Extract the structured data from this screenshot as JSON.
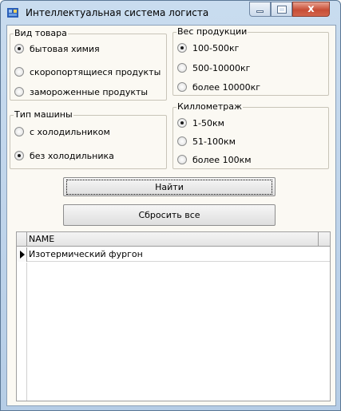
{
  "window": {
    "title": "Интеллектуальная система логиста",
    "controls": {
      "minimize": "",
      "maximize": "",
      "close": "x"
    }
  },
  "product_type": {
    "legend": "Вид товара",
    "options": [
      {
        "label": "бытовая химия",
        "selected": true
      },
      {
        "label": "скоропортящиеся продукты",
        "selected": false
      },
      {
        "label": "замороженные продукты",
        "selected": false
      }
    ]
  },
  "weight": {
    "legend": "Вес продукции",
    "options": [
      {
        "label": "100-500кг",
        "selected": true
      },
      {
        "label": "500-10000кг",
        "selected": false
      },
      {
        "label": "более 10000кг",
        "selected": false
      }
    ]
  },
  "vehicle_type": {
    "legend": "Тип машины",
    "options": [
      {
        "label": "с холодильником",
        "selected": false
      },
      {
        "label": "без холодильника",
        "selected": true
      }
    ]
  },
  "distance": {
    "legend": "Киллометраж",
    "options": [
      {
        "label": "1-50км",
        "selected": true
      },
      {
        "label": "51-100км",
        "selected": false
      },
      {
        "label": "более 100км",
        "selected": false
      }
    ]
  },
  "buttons": {
    "find": "Найти",
    "reset": "Сбросить все"
  },
  "results": {
    "columns": [
      "NAME"
    ],
    "rows": [
      {
        "name": "Изотермический фургон",
        "current": true
      }
    ]
  },
  "colors": {
    "client_bg": "#fbf9f3",
    "title_bar": "#c9dcef",
    "close_button": "#c74d36"
  }
}
